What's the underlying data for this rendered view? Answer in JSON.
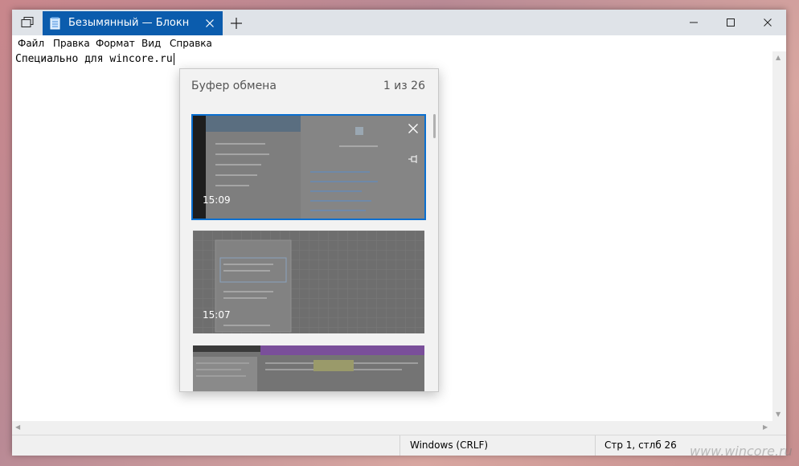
{
  "window": {
    "tab_title": "Безымянный — Блокн",
    "new_tab_glyph": "+",
    "icons": {
      "task_view": "task-view-icon",
      "tab_app": "notepad-icon",
      "tab_close": "close-icon",
      "minimize": "minimize-icon",
      "maximize": "maximize-icon",
      "close": "close-icon"
    }
  },
  "menubar": {
    "items": [
      "Файл",
      "Правка",
      "Формат",
      "Вид",
      "Справка"
    ]
  },
  "editor": {
    "text": "Специально для wincore.ru"
  },
  "statusbar": {
    "encoding": "Windows (CRLF)",
    "position": "Стр 1, стлб 26"
  },
  "clipboard": {
    "title": "Буфер обмена",
    "count": "1 из 26",
    "items": [
      {
        "time": "15:09",
        "selected": true
      },
      {
        "time": "15:07",
        "selected": false
      },
      {
        "time": "",
        "selected": false
      }
    ]
  },
  "watermark": "www.wincore.ru",
  "colors": {
    "accent": "#0b5cad",
    "selection_outline": "#0a6fd0"
  }
}
